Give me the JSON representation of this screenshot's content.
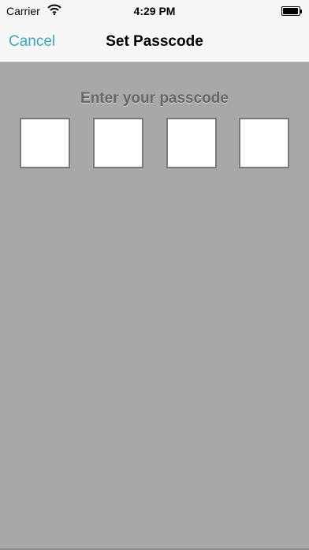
{
  "status_bar": {
    "carrier": "Carrier",
    "time": "4:29 PM",
    "wifi_icon": "wifi-icon",
    "battery_icon": "battery-icon"
  },
  "nav": {
    "cancel_label": "Cancel",
    "title": "Set Passcode",
    "accent_color": "#3aa6c4"
  },
  "passcode": {
    "prompt": "Enter your passcode",
    "digit_count": 4,
    "digits": [
      "",
      "",
      "",
      ""
    ]
  },
  "colors": {
    "background": "#a8a8a8",
    "bar": "#f7f7f7",
    "prompt_text": "#666666"
  }
}
